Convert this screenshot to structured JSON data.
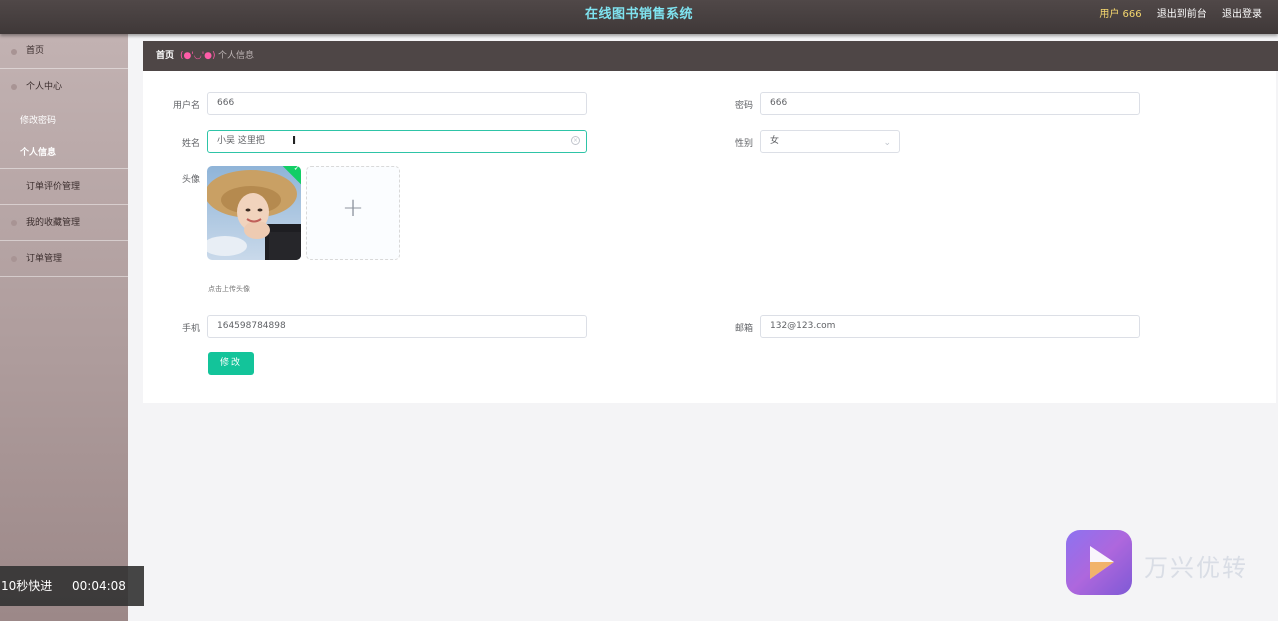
{
  "header": {
    "title": "在线图书销售系统",
    "user_label": "用户 666",
    "front_link": "退出到前台",
    "logout_link": "退出登录"
  },
  "sidebar": {
    "items": [
      {
        "label": "首页"
      },
      {
        "label": "个人中心",
        "children": [
          {
            "label": "修改密码"
          },
          {
            "label": "个人信息"
          }
        ]
      },
      {
        "label": "订单评价管理"
      },
      {
        "label": "我的收藏管理"
      },
      {
        "label": "订单管理"
      }
    ]
  },
  "breadcrumb": {
    "home": "首页",
    "separator": "(●'◡'●)",
    "current": "个人信息"
  },
  "form": {
    "username": {
      "label": "用户名",
      "value": "666"
    },
    "password": {
      "label": "密码",
      "value": "666"
    },
    "name": {
      "label": "姓名",
      "value": "小吴 这里把"
    },
    "gender": {
      "label": "性别",
      "value": "女"
    },
    "avatar": {
      "label": "头像",
      "tip": "点击上传头像",
      "upload_icon": "+"
    },
    "phone": {
      "label": "手机",
      "value": "164598784898"
    },
    "email": {
      "label": "邮箱",
      "value": "132@123.com"
    },
    "submit_label": "修改"
  },
  "overlay": {
    "speed_label": "10秒快进",
    "time": "00:04:08",
    "watermark": "万兴优转"
  },
  "colors": {
    "accent": "#13c49a",
    "header_bg": "#4e4646",
    "title_color": "#7fe3f0"
  }
}
